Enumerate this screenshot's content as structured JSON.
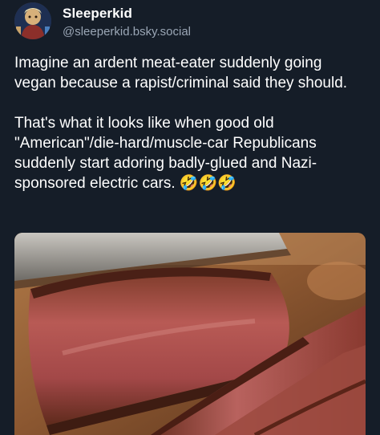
{
  "author": {
    "display_name": "Sleeperkid",
    "handle": "@sleeperkid.bsky.social",
    "avatar_icon": "avatar-illustration"
  },
  "post": {
    "paragraph_1": "Imagine an ardent meat-eater suddenly going vegan because a rapist/criminal said they should.",
    "paragraph_2": "That's what it looks like when good old \"American\"/die-hard/muscle-car Republicans suddenly start adoring badly-glued and Nazi-sponsored electric cars. 🤣🤣🤣"
  },
  "media": {
    "icon": "steak-photo"
  },
  "colors": {
    "background": "#151d28",
    "text": "#ffffff",
    "handle": "#9aa6b5"
  }
}
